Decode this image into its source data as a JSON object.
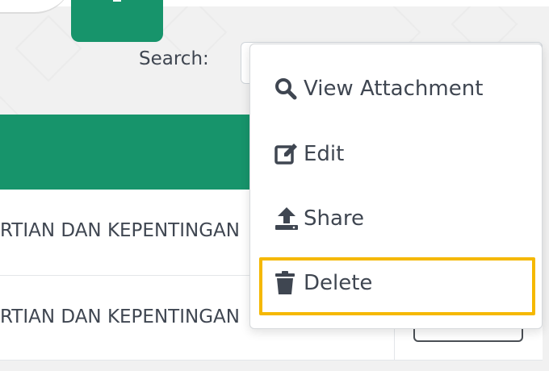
{
  "toolbar": {
    "search_label": "Search:"
  },
  "table": {
    "rows": [
      {
        "title": "RTIAN DAN KEPENTINGAN"
      },
      {
        "title": "RTIAN DAN KEPENTINGAN"
      }
    ]
  },
  "dropdown": {
    "items": [
      {
        "label": "View Attachment",
        "icon": "search-icon"
      },
      {
        "label": "Edit",
        "icon": "edit-icon"
      },
      {
        "label": "Share",
        "icon": "upload-icon"
      },
      {
        "label": "Delete",
        "icon": "trash-icon"
      }
    ],
    "highlighted_index": 3
  },
  "colors": {
    "brand_green": "#17946b",
    "highlight": "#f5b800",
    "text": "#3f4651"
  }
}
